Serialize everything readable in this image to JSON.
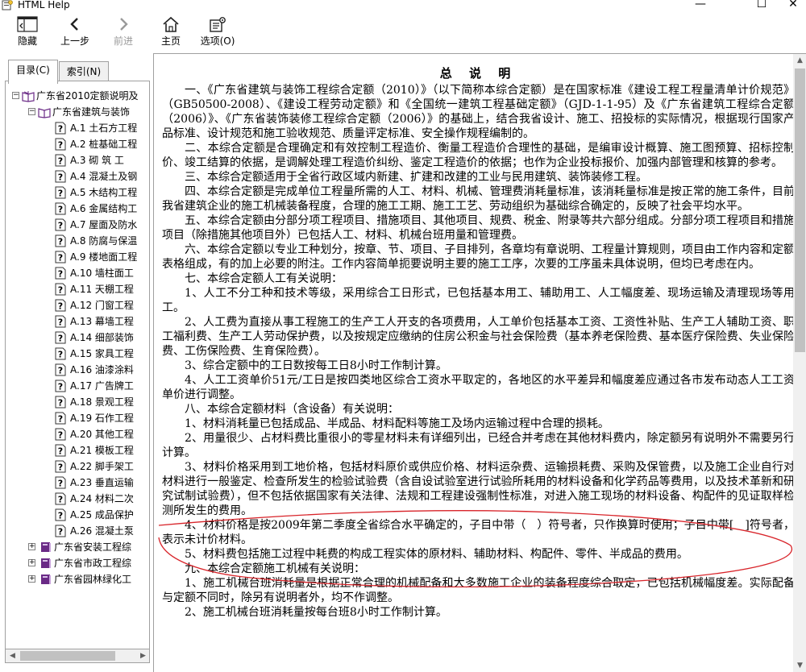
{
  "window": {
    "title": "HTML Help",
    "minimize": "—",
    "maximize": "☐",
    "close": "✕"
  },
  "toolbar": {
    "hide": "隐藏",
    "back": "上一步",
    "forward": "前进",
    "home": "主页",
    "options": "选项(O)"
  },
  "tabs": {
    "contents": "目录(C)",
    "index": "索引(N)"
  },
  "tree": {
    "root": "广东省2010定额说明及",
    "book1": "广东省建筑与装饰",
    "items": [
      "A.1  土石方工程",
      "A.2  桩基础工程",
      "A.3  砌 筑 工",
      "A.4  混凝土及钢",
      "A.5  木结构工程",
      "A.6  金属结构工",
      "A.7  屋面及防水",
      "A.8  防腐与保温",
      "A.9  楼地面工程",
      "A.10  墙柱面工",
      "A.11  天棚工程",
      "A.12  门窗工程",
      "A.13  幕墙工程",
      "A.14  细部装饰",
      "A.15  家具工程",
      "A.16  油漆涂料",
      "A.17  广告牌工",
      "A.18  景观工程",
      "A.19  石作工程",
      "A.20  其他工程",
      "A.21  模板工程",
      "A.22  脚手架工",
      "A.23  垂直运输",
      "A.24  材料二次",
      "A.25  成品保护",
      "A.26  混凝土泵"
    ],
    "book2": "广东省安装工程综",
    "book3": "广东省市政工程综",
    "book4": "广东省园林绿化工"
  },
  "doc": {
    "title": "总 说 明",
    "paragraphs": [
      "一、《广东省建筑与装饰工程综合定额（2010）》（以下简称本综合定额）是在国家标准《建设工程工程量清单计价规范》（GB50500-2008）、《建设工程劳动定额》和《全国统一建筑工程基础定额》（GJD-1-1-95）及《广东省建筑工程综合定额（2006）》、《广东省装饰装修工程综合定额（2006）》的基础上，结合我省设计、施工、招投标的实际情况，根据现行国家产品标准、设计规范和施工验收规范、质量评定标准、安全操作规程编制的。",
      "二、本综合定额是合理确定和有效控制工程造价、衡量工程造价合理性的基础，是编审设计概算、施工图预算、招标控制价、竣工结算的依据，是调解处理工程造价纠纷、鉴定工程造价的依据；也作为企业投标报价、加强内部管理和核算的参考。",
      "三、本综合定额适用于全省行政区域内新建、扩建和改建的工业与民用建筑、装饰装修工程。",
      "四、本综合定额是完成单位工程量所需的人工、材料、机械、管理费消耗量标准，该消耗量标准是按正常的施工条件，目前我省建筑企业的施工机械装备程度，合理的施工工期、施工工艺、劳动组织为基础综合确定的，反映了社会平均水平。",
      "五、本综合定额由分部分项工程项目、措施项目、其他项目、规费、税金、附录等共六部分组成。分部分项工程项目和措施项目（除措施其他项目外）已包括人工、材料、机械台班用量和管理费。",
      "六、本综合定额以专业工种划分，按章、节、项目、子目排列，各章均有章说明、工程量计算规则，项目由工作内容和定额表格组成，有的加上必要的附注。工作内容简单扼要说明主要的施工工序，次要的工序虽未具体说明，但均已考虑在内。",
      "七、本综合定额人工有关说明：",
      "1、人工不分工种和技术等级，采用综合工日形式，已包括基本用工、辅助用工、人工幅度差、现场运输及清理现场等用工。",
      "2、人工费为直接从事工程施工的生产工人开支的各项费用，人工单价包括基本工资、工资性补贴、生产工人辅助工资、职工福利费、生产工人劳动保护费，以及按规定应缴纳的住房公积金与社会保险费（基本养老保险费、基本医疗保险费、失业保险费、工伤保险费、生育保险费）。",
      "3、综合定额中的工日数按每工日8小时工作制计算。",
      "4、人工工资单价51元/工日是按四类地区综合工资水平取定的，各地区的水平差异和幅度差应通过各市发布动态人工工资单价进行调整。",
      "八、本综合定额材料（含设备）有关说明：",
      "1、材料消耗量已包括成品、半成品、材料配料等施工及场内运输过程中合理的损耗。",
      "2、用量很少、占材料费比重很小的零星材料未有详细列出，已经合并考虑在其他材料费内，除定额另有说明外不需要另行计算。",
      "3、材料价格采用到工地价格，包括材料原价或供应价格、材料运杂费、运输损耗费、采购及保管费，以及施工企业自行对材料进行一般鉴定、检查所发生的检验试验费（含自设试验室进行试验所耗用的材料设备和化学药品等费用，以及技术革新和研究试制试验费），但不包括依据国家有关法律、法规和工程建设强制性标准，对进入施工现场的材料设备、构配件的见证取样检测所发生的费用。",
      "4、材料价格是按2009年第二季度全省综合水平确定的，子目中带（　）符号者，只作换算时使用；子目中带[　]符号者，表示未计价材料。",
      "5、材料费包括施工过程中耗费的构成工程实体的原材料、辅助材料、构配件、零件、半成品的费用。",
      "九、本综合定额施工机械有关说明：",
      "1、施工机械台班消耗量是根据正常合理的机械配备和大多数施工企业的装备程度综合取定，已包括机械幅度差。实际配备与定额不同时，除另有说明者外，均不作调整。",
      "2、施工机械台班消耗量按每台班8小时工作制计算。"
    ]
  },
  "colors": {
    "annotation_red": "#d8242a",
    "book_purple": "#6a2a86",
    "scrollbar_thumb": "#c1c1c1"
  }
}
